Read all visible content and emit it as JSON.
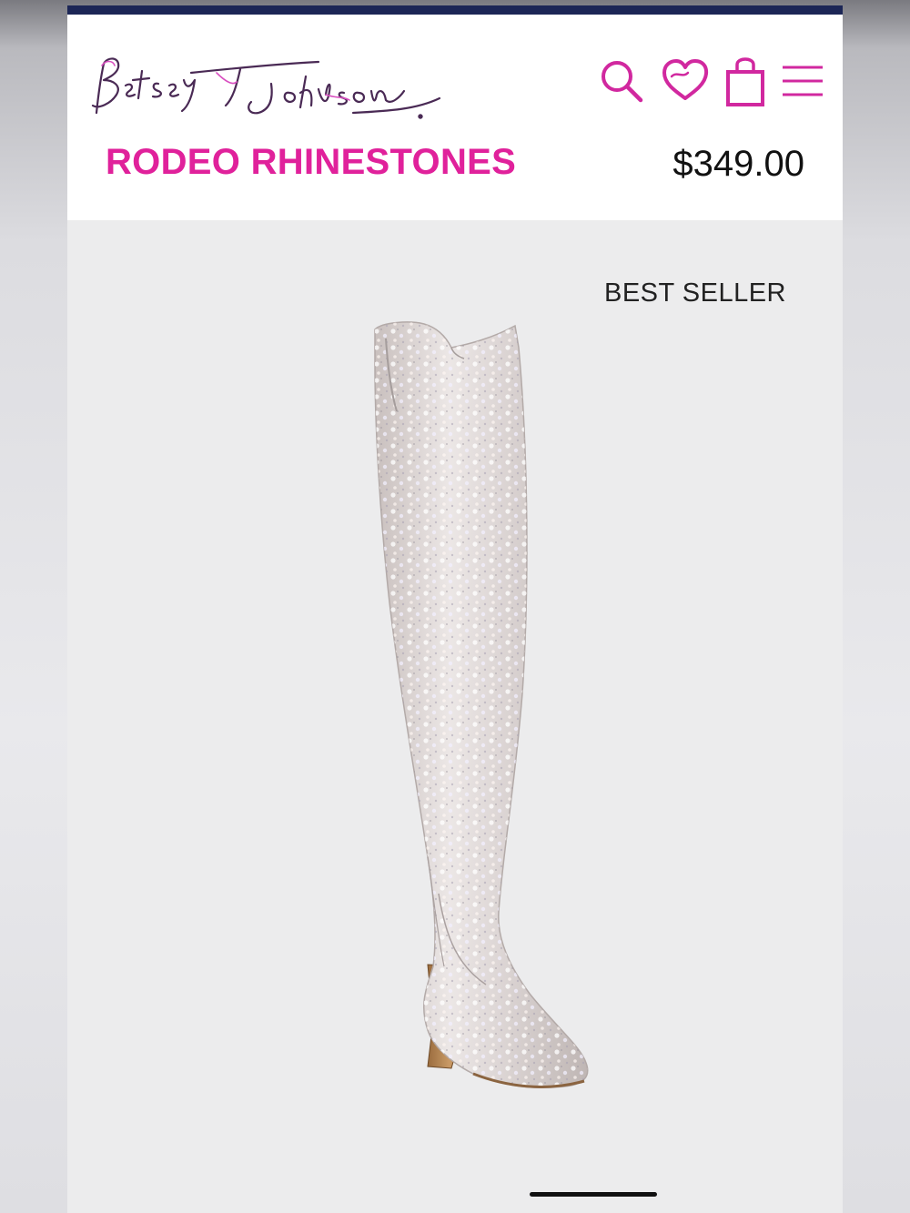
{
  "brand": {
    "logo_text": "Betsey Johnson"
  },
  "header": {
    "icons": [
      "search-icon",
      "wishlist-heart-icon",
      "shopping-bag-icon",
      "hamburger-menu-icon"
    ],
    "accent_color": "#e0219b",
    "bar_color": "#1c2656"
  },
  "product": {
    "name": "RODEO RHINESTONES",
    "price": "$349.00",
    "badge": "BEST SELLER"
  }
}
